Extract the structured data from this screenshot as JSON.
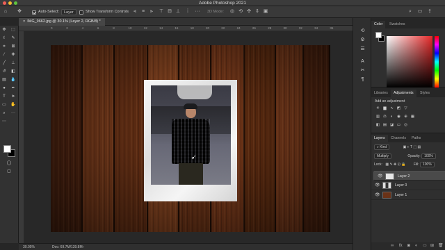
{
  "app": {
    "title": "Adobe Photoshop 2021"
  },
  "options_bar": {
    "auto_select_label": "Auto-Select:",
    "auto_select_value": "Layer",
    "show_transform_label": "Show Transform Controls",
    "mode_3d_label": "3D Mode:"
  },
  "document": {
    "tab_label": "IMG_9662.jpg @ 30.1% (Layer 2, RGB/8) *"
  },
  "rulers": {
    "ticks": [
      "0",
      "2",
      "4",
      "6",
      "8",
      "10",
      "12",
      "14",
      "16",
      "18",
      "20",
      "22",
      "24",
      "26",
      "28",
      "30",
      "32",
      "34",
      "36"
    ]
  },
  "status": {
    "zoom": "30.05%",
    "doc_info": "Doc: 69.7M/139.8M"
  },
  "color_panel": {
    "tabs": [
      "Color",
      "Swatches"
    ]
  },
  "adjustments_panel": {
    "tabs": [
      "Libraries",
      "Adjustments",
      "Styles"
    ],
    "active_tab": "Adjustments",
    "prompt": "Add an adjustment"
  },
  "layers_panel": {
    "tabs": [
      "Layers",
      "Channels",
      "Paths"
    ],
    "filter_kind": "Kind",
    "blend_mode": "Multiply",
    "opacity_label": "Opacity:",
    "opacity_value": "100%",
    "lock_label": "Lock:",
    "fill_label": "Fill:",
    "fill_value": "100%",
    "layers": [
      {
        "name": "Layer 2",
        "selected": true
      },
      {
        "name": "Layer 0",
        "selected": false
      },
      {
        "name": "Layer 1",
        "selected": false
      }
    ]
  },
  "colors": {
    "accent": "#4a4a4a",
    "foreground": "#ffffff",
    "background": "#000000"
  }
}
